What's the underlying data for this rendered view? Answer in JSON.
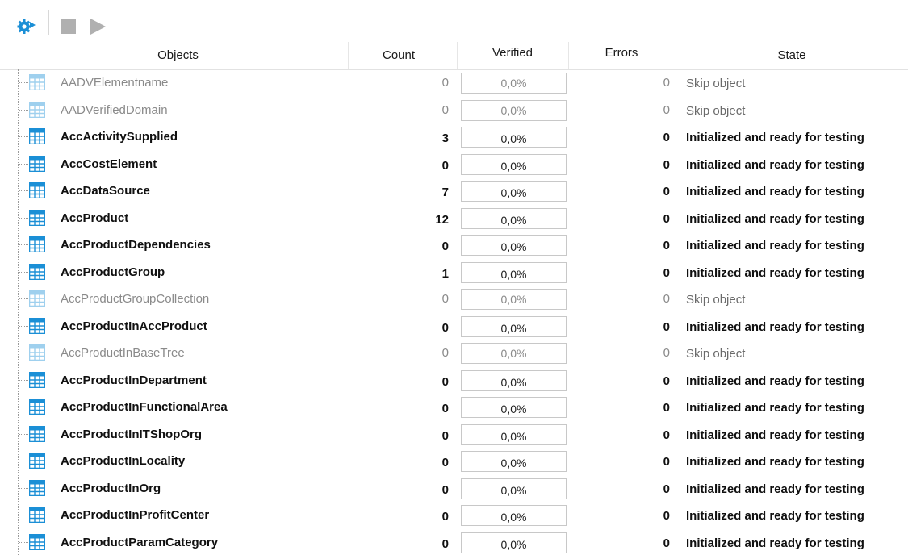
{
  "toolbar": {
    "config_icon": "gear-run-icon",
    "stop_icon": "stop-icon",
    "play_icon": "play-icon"
  },
  "columns": {
    "objects": "Objects",
    "count": "Count",
    "verified": "Verified",
    "errors": "Errors",
    "state": "State"
  },
  "colors": {
    "accent": "#1b8fd6",
    "table_icon_active": "#1b8fd6",
    "table_icon_skipped": "#9fd0ee",
    "disabled_toolbar": "#b0b0b0"
  },
  "rows": [
    {
      "name": "AADVElementname",
      "count": "0",
      "verified": "0,0%",
      "errors": "0",
      "state": "Skip object",
      "skip": true
    },
    {
      "name": "AADVerifiedDomain",
      "count": "0",
      "verified": "0,0%",
      "errors": "0",
      "state": "Skip object",
      "skip": true
    },
    {
      "name": "AccActivitySupplied",
      "count": "3",
      "verified": "0,0%",
      "errors": "0",
      "state": "Initialized and ready for testing",
      "skip": false
    },
    {
      "name": "AccCostElement",
      "count": "0",
      "verified": "0,0%",
      "errors": "0",
      "state": "Initialized and ready for testing",
      "skip": false
    },
    {
      "name": "AccDataSource",
      "count": "7",
      "verified": "0,0%",
      "errors": "0",
      "state": "Initialized and ready for testing",
      "skip": false
    },
    {
      "name": "AccProduct",
      "count": "12",
      "verified": "0,0%",
      "errors": "0",
      "state": "Initialized and ready for testing",
      "skip": false
    },
    {
      "name": "AccProductDependencies",
      "count": "0",
      "verified": "0,0%",
      "errors": "0",
      "state": "Initialized and ready for testing",
      "skip": false
    },
    {
      "name": "AccProductGroup",
      "count": "1",
      "verified": "0,0%",
      "errors": "0",
      "state": "Initialized and ready for testing",
      "skip": false
    },
    {
      "name": "AccProductGroupCollection",
      "count": "0",
      "verified": "0,0%",
      "errors": "0",
      "state": "Skip object",
      "skip": true
    },
    {
      "name": "AccProductInAccProduct",
      "count": "0",
      "verified": "0,0%",
      "errors": "0",
      "state": "Initialized and ready for testing",
      "skip": false
    },
    {
      "name": "AccProductInBaseTree",
      "count": "0",
      "verified": "0,0%",
      "errors": "0",
      "state": "Skip object",
      "skip": true
    },
    {
      "name": "AccProductInDepartment",
      "count": "0",
      "verified": "0,0%",
      "errors": "0",
      "state": "Initialized and ready for testing",
      "skip": false
    },
    {
      "name": "AccProductInFunctionalArea",
      "count": "0",
      "verified": "0,0%",
      "errors": "0",
      "state": "Initialized and ready for testing",
      "skip": false
    },
    {
      "name": "AccProductInITShopOrg",
      "count": "0",
      "verified": "0,0%",
      "errors": "0",
      "state": "Initialized and ready for testing",
      "skip": false
    },
    {
      "name": "AccProductInLocality",
      "count": "0",
      "verified": "0,0%",
      "errors": "0",
      "state": "Initialized and ready for testing",
      "skip": false
    },
    {
      "name": "AccProductInOrg",
      "count": "0",
      "verified": "0,0%",
      "errors": "0",
      "state": "Initialized and ready for testing",
      "skip": false
    },
    {
      "name": "AccProductInProfitCenter",
      "count": "0",
      "verified": "0,0%",
      "errors": "0",
      "state": "Initialized and ready for testing",
      "skip": false
    },
    {
      "name": "AccProductParamCategory",
      "count": "0",
      "verified": "0,0%",
      "errors": "0",
      "state": "Initialized and ready for testing",
      "skip": false
    }
  ]
}
